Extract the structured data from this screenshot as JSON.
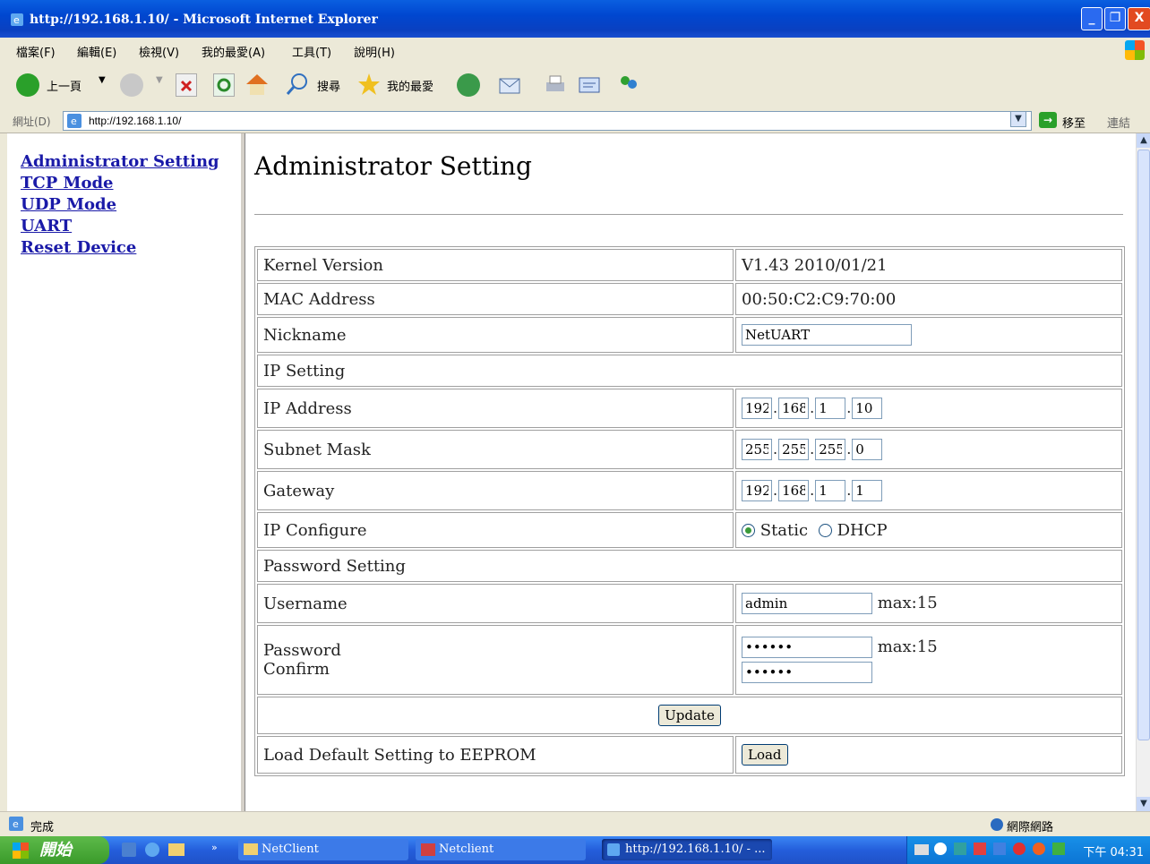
{
  "window": {
    "title": "http://192.168.1.10/ - Microsoft Internet Explorer",
    "min_glyph": "_",
    "max_glyph": "❐",
    "close_glyph": "X"
  },
  "menu": [
    "檔案(F)",
    "編輯(E)",
    "檢視(V)",
    "我的最愛(A)",
    "工具(T)",
    "說明(H)"
  ],
  "toolbar": {
    "back": "上一頁",
    "search": "搜尋",
    "favorites": "我的最愛"
  },
  "address": {
    "label": "網址(D)",
    "url": "http://192.168.1.10/",
    "go": "移至",
    "links": "連結"
  },
  "nav": {
    "items": [
      "Administrator Setting",
      "TCP Mode",
      "UDP Mode",
      "UART",
      "Reset Device"
    ]
  },
  "page": {
    "title": "Administrator Setting",
    "kernel_label": "Kernel Version",
    "kernel_value": "V1.43 2010/01/21",
    "mac_label": "MAC Address",
    "mac_value": "00:50:C2:C9:70:00",
    "nickname_label": "Nickname",
    "nickname_value": "NetUART",
    "ip_setting_header": "IP Setting",
    "ip_label": "IP Address",
    "ip": [
      "192",
      "168",
      "1",
      "10"
    ],
    "subnet_label": "Subnet Mask",
    "subnet": [
      "255",
      "255",
      "255",
      "0"
    ],
    "gateway_label": "Gateway",
    "gateway": [
      "192",
      "168",
      "1",
      "1"
    ],
    "ipconf_label": "IP Configure",
    "ipconf_static": "Static",
    "ipconf_dhcp": "DHCP",
    "ipconf_selected": "Static",
    "password_header": "Password Setting",
    "username_label": "Username",
    "username_value": "admin",
    "max_hint": "max:15",
    "password_label": "Password",
    "confirm_label": "Confirm",
    "password_value": "••••••",
    "confirm_value": "••••••",
    "update_button": "Update",
    "load_label": "Load Default Setting to EEPROM",
    "load_button": "Load"
  },
  "status": {
    "text": "完成",
    "zone": "網際網路"
  },
  "taskbar": {
    "start": "開始",
    "tasks": [
      "NetClient",
      "Netclient",
      "http://192.168.1.10/ - ..."
    ],
    "clock": "下午 04:31"
  },
  "colors": {
    "link": "#1a1aa8",
    "titlebar": "#0047d0",
    "taskbar": "#245edb"
  }
}
